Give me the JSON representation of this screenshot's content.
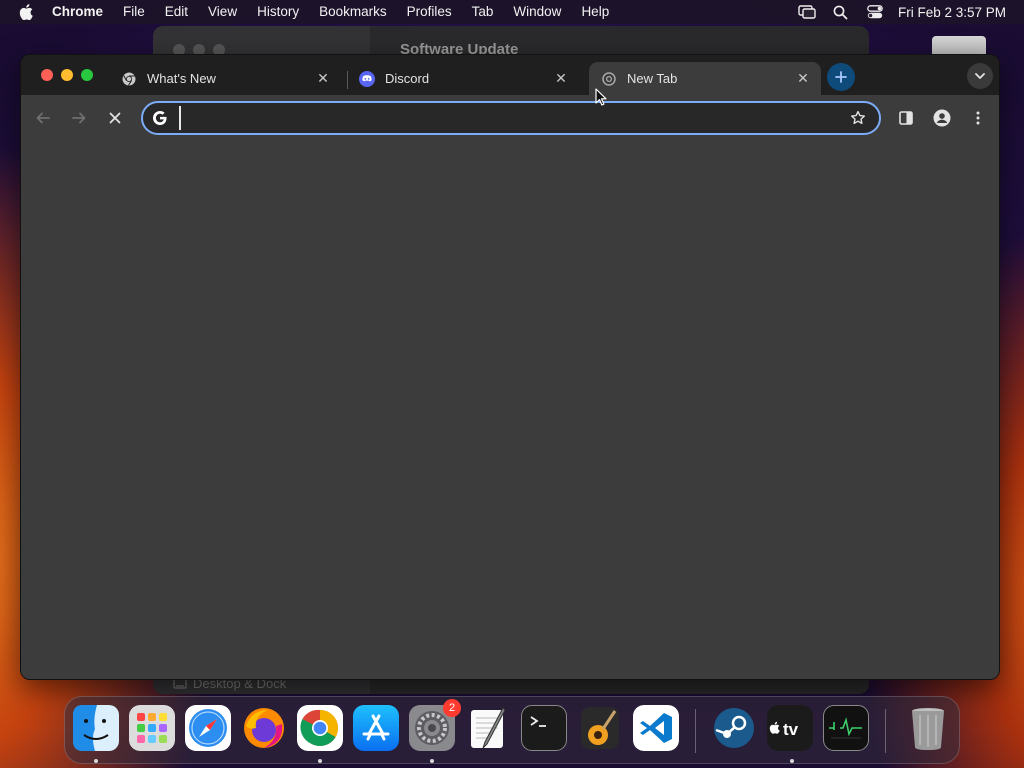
{
  "menubar": {
    "app_name": "Chrome",
    "items": [
      "File",
      "Edit",
      "View",
      "History",
      "Bookmarks",
      "Profiles",
      "Tab",
      "Window",
      "Help"
    ],
    "clock": "Fri Feb 2  3:57 PM"
  },
  "background_window": {
    "title": "Software Update",
    "sidebar_bottom_item": "Desktop & Dock"
  },
  "chrome": {
    "tabs": [
      {
        "title": "What's New",
        "favicon": "chrome-icon",
        "active": false
      },
      {
        "title": "Discord",
        "favicon": "discord-icon",
        "active": false
      },
      {
        "title": "New Tab",
        "favicon": "chrome-newtab-icon",
        "active": true
      }
    ],
    "omnibox": {
      "value": "",
      "placeholder": ""
    },
    "accent": "#7cacf8"
  },
  "dock": {
    "apps": [
      {
        "name": "Finder",
        "icon": "finder-icon",
        "running": true
      },
      {
        "name": "Launchpad",
        "icon": "launchpad-icon",
        "running": false
      },
      {
        "name": "Safari",
        "icon": "safari-icon",
        "running": false
      },
      {
        "name": "Firefox",
        "icon": "firefox-icon",
        "running": false
      },
      {
        "name": "Chrome",
        "icon": "chrome-icon",
        "running": true
      },
      {
        "name": "App Store",
        "icon": "app-store-icon",
        "running": false
      },
      {
        "name": "System Settings",
        "icon": "settings-icon",
        "running": true,
        "badge": "2"
      },
      {
        "name": "TextEdit",
        "icon": "textedit-icon",
        "running": false
      },
      {
        "name": "Terminal",
        "icon": "terminal-icon",
        "running": false
      },
      {
        "name": "GarageBand",
        "icon": "garageband-icon",
        "running": false
      },
      {
        "name": "Visual Studio Code",
        "icon": "vscode-icon",
        "running": false
      },
      {
        "name": "Steam",
        "icon": "steam-icon",
        "running": false
      },
      {
        "name": "TV",
        "icon": "apple-tv-icon",
        "running": true
      },
      {
        "name": "Activity Monitor",
        "icon": "activity-monitor-icon",
        "running": false
      },
      {
        "name": "Trash",
        "icon": "trash-icon",
        "running": false
      }
    ],
    "tv_label": "tv"
  }
}
